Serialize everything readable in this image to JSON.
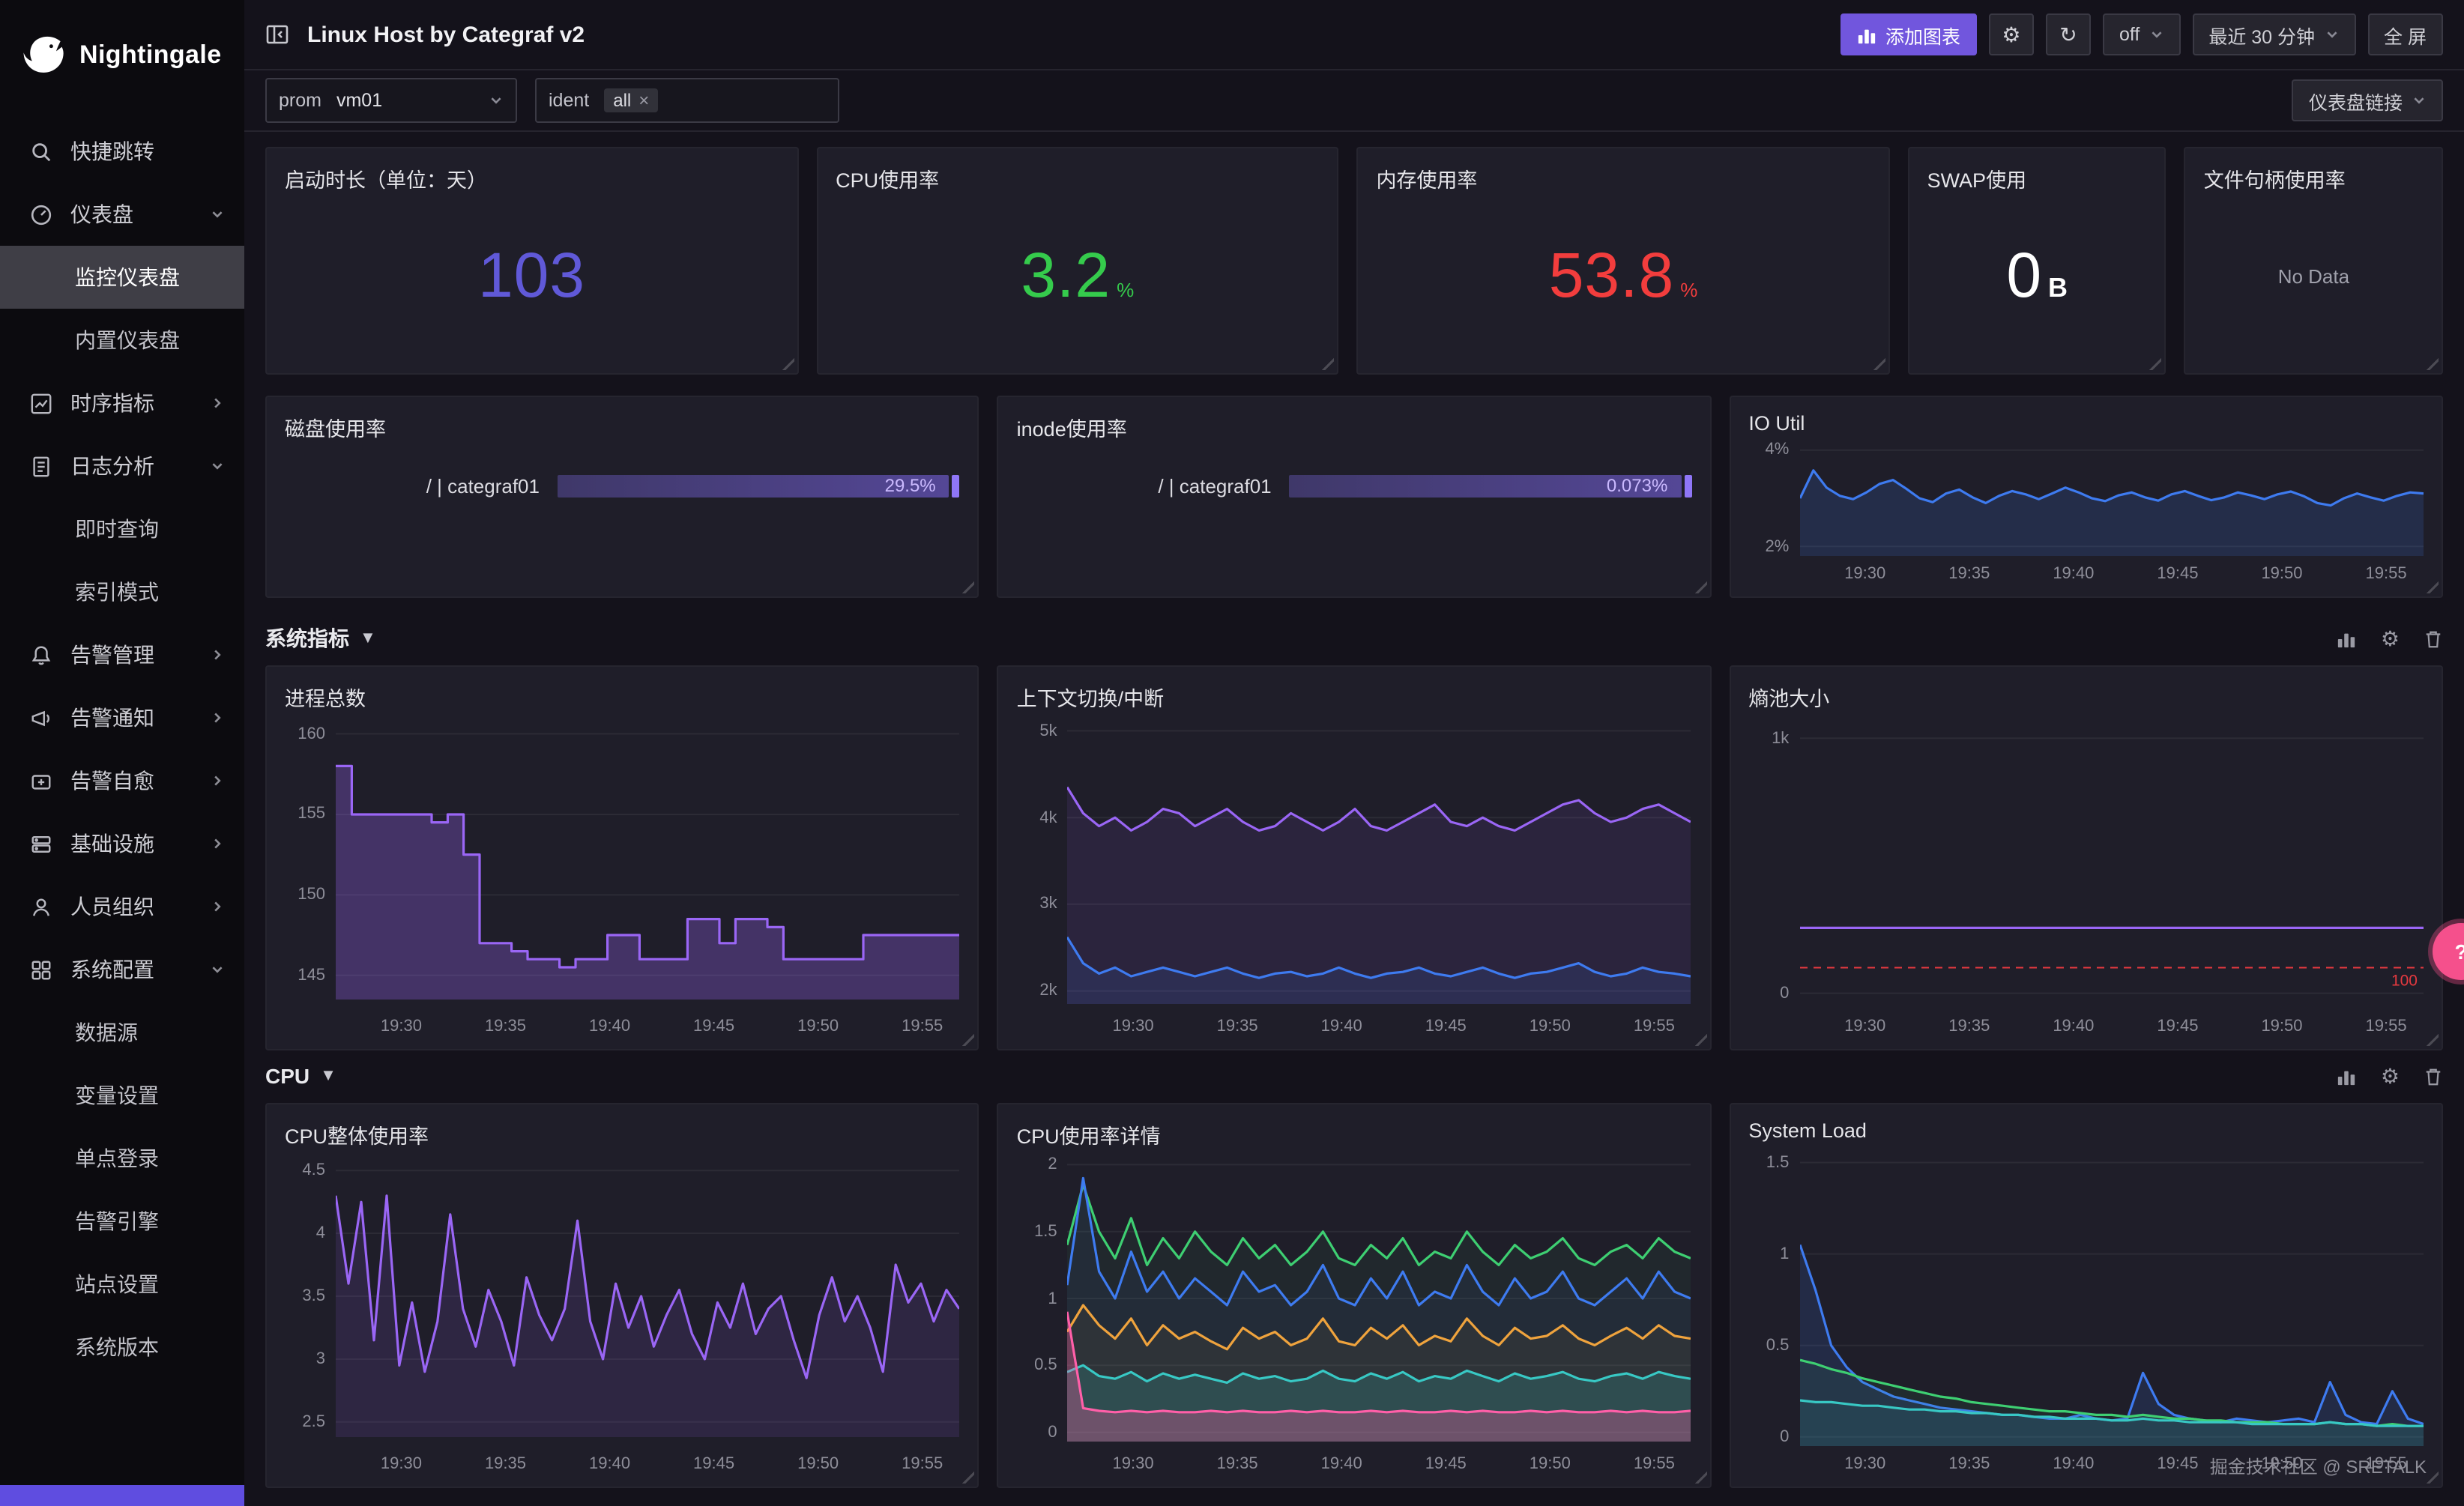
{
  "sidebar": {
    "logo_text": "Nightingale",
    "items": [
      {
        "key": "quick-jump",
        "label": "快捷跳转",
        "icon": "search",
        "type": "top"
      },
      {
        "key": "dashboards",
        "label": "仪表盘",
        "icon": "gauge",
        "chevron": "down",
        "type": "top"
      },
      {
        "key": "monitor-dashboards",
        "label": "监控仪表盘",
        "type": "child",
        "active": true
      },
      {
        "key": "builtin-dashboards",
        "label": "内置仪表盘",
        "type": "child"
      },
      {
        "key": "metrics",
        "label": "时序指标",
        "icon": "chart",
        "chevron": "right",
        "type": "top"
      },
      {
        "key": "log-analysis",
        "label": "日志分析",
        "icon": "log",
        "chevron": "down",
        "type": "top"
      },
      {
        "key": "instant-query",
        "label": "即时查询",
        "type": "child"
      },
      {
        "key": "index-pattern",
        "label": "索引模式",
        "type": "child"
      },
      {
        "key": "alert-manage",
        "label": "告警管理",
        "icon": "bell",
        "chevron": "right",
        "type": "top"
      },
      {
        "key": "alert-notify",
        "label": "告警通知",
        "icon": "speaker",
        "chevron": "right",
        "type": "top"
      },
      {
        "key": "alert-selfheal",
        "label": "告警自愈",
        "icon": "heal",
        "chevron": "right",
        "type": "top"
      },
      {
        "key": "infrastructure",
        "label": "基础设施",
        "icon": "server",
        "chevron": "right",
        "type": "top"
      },
      {
        "key": "org",
        "label": "人员组织",
        "icon": "user",
        "chevron": "right",
        "type": "top"
      },
      {
        "key": "system-config",
        "label": "系统配置",
        "icon": "grid",
        "chevron": "down",
        "type": "top"
      },
      {
        "key": "datasource",
        "label": "数据源",
        "type": "child"
      },
      {
        "key": "variables",
        "label": "变量设置",
        "type": "child"
      },
      {
        "key": "sso",
        "label": "单点登录",
        "type": "child"
      },
      {
        "key": "alert-engine",
        "label": "告警引擎",
        "type": "child"
      },
      {
        "key": "site-settings",
        "label": "站点设置",
        "type": "child"
      },
      {
        "key": "system-version",
        "label": "系统版本",
        "type": "child"
      }
    ]
  },
  "header": {
    "title": "Linux Host by Categraf v2",
    "add_chart": "添加图表",
    "refresh_interval": "off",
    "time_range": "最近 30 分钟",
    "fullscreen": "全 屏"
  },
  "filters": {
    "prom_label": "prom",
    "prom_value": "vm01",
    "ident_label": "ident",
    "ident_value": "all",
    "links": "仪表盘链接"
  },
  "sections": [
    {
      "label": "系统指标"
    },
    {
      "label": "CPU"
    }
  ],
  "watermark": "掘金技术社区 @ SRETALK",
  "stat_cards": [
    {
      "key": "uptime",
      "title": "启动时长（单位：天）",
      "value": "103",
      "unit": "",
      "color": "#6059d8"
    },
    {
      "key": "cpu-usage",
      "title": "CPU使用率",
      "value": "3.2",
      "unit": "%",
      "color": "#35cb4c"
    },
    {
      "key": "mem-usage",
      "title": "内存使用率",
      "value": "53.8",
      "unit": "%",
      "color": "#f23d3d"
    },
    {
      "key": "swap-usage",
      "title": "SWAP使用",
      "value": "0",
      "unit": "B",
      "color": "#ffffff"
    },
    {
      "key": "filefd-usage",
      "title": "文件句柄使用率",
      "value": "No Data",
      "unit": "",
      "color": "#9fa0ab",
      "nodata": true
    }
  ],
  "gauge_panels": [
    {
      "key": "disk-usage",
      "title": "磁盘使用率",
      "row_label": "/ | categraf01",
      "value": "29.5%"
    },
    {
      "key": "inode-usage",
      "title": "inode使用率",
      "row_label": "/ | categraf01",
      "value": "0.073%"
    }
  ],
  "chart_defaults": {
    "x_ticks": [
      "19:30",
      "19:35",
      "19:40",
      "19:45",
      "19:50",
      "19:55"
    ]
  },
  "chart_data": [
    {
      "key": "io-util",
      "row": "row2",
      "title": "IO Util",
      "type": "line",
      "y_min": 1.8,
      "y_max": 4.2,
      "y_ticks": [
        {
          "v": 4,
          "l": "4%"
        },
        {
          "v": 2,
          "l": "2%"
        }
      ],
      "series": [
        {
          "name": "io-util",
          "color": "#3e7bf0",
          "fill": 0.16,
          "values": [
            3.0,
            3.58,
            3.22,
            3.05,
            2.98,
            3.12,
            3.3,
            3.38,
            3.2,
            3.0,
            2.92,
            3.1,
            3.18,
            3.02,
            2.9,
            3.05,
            3.15,
            3.08,
            2.98,
            3.1,
            3.22,
            3.12,
            3.0,
            2.94,
            3.06,
            3.12,
            3.02,
            2.95,
            3.08,
            3.15,
            3.05,
            2.96,
            3.02,
            3.12,
            3.06,
            2.98,
            3.08,
            3.14,
            3.04,
            2.9,
            2.85,
            3.0,
            3.1,
            3.02,
            2.95,
            3.05,
            3.12,
            3.1
          ]
        }
      ]
    },
    {
      "key": "process-total",
      "row": "row3",
      "title": "进程总数",
      "type": "line",
      "step": true,
      "y_min": 143.5,
      "y_max": 161,
      "y_ticks": [
        {
          "v": 160,
          "l": "160"
        },
        {
          "v": 155,
          "l": "155"
        },
        {
          "v": 150,
          "l": "150"
        },
        {
          "v": 145,
          "l": "145"
        }
      ],
      "series": [
        {
          "name": "processes",
          "color": "#9a66f5",
          "fill": 0.3,
          "values": [
            158,
            155,
            155,
            155,
            155,
            155,
            154.5,
            155,
            152.5,
            147,
            147,
            146.5,
            146,
            146,
            145.5,
            146,
            146,
            147.5,
            147.5,
            146,
            146,
            146,
            148.5,
            148.5,
            147,
            148.5,
            148.5,
            148,
            146,
            146,
            146,
            146,
            146,
            147.5,
            147.5,
            147.5,
            147.5,
            147.5,
            147.5,
            147.5
          ]
        }
      ]
    },
    {
      "key": "context-switch",
      "row": "row3",
      "title": "上下文切换/中断",
      "type": "line",
      "y_min": 1850,
      "y_max": 5150,
      "y_ticks": [
        {
          "v": 5000,
          "l": "5k"
        },
        {
          "v": 4000,
          "l": "4k"
        },
        {
          "v": 3000,
          "l": "3k"
        },
        {
          "v": 2000,
          "l": "2k"
        }
      ],
      "series": [
        {
          "name": "context-switch",
          "color": "#9a66f5",
          "fill": 0.1,
          "values": [
            4350,
            4050,
            3900,
            4000,
            3850,
            3950,
            4100,
            4050,
            3900,
            4000,
            4100,
            3950,
            3850,
            3900,
            4050,
            3950,
            3850,
            3950,
            4100,
            3900,
            3850,
            3950,
            4050,
            4150,
            3950,
            3900,
            4000,
            3900,
            3850,
            3950,
            4050,
            4150,
            4200,
            4050,
            3950,
            4000,
            4100,
            4150,
            4050,
            3950
          ]
        },
        {
          "name": "interrupts",
          "color": "#3e7bf0",
          "fill": 0.12,
          "values": [
            2620,
            2320,
            2200,
            2270,
            2170,
            2220,
            2270,
            2220,
            2170,
            2220,
            2270,
            2200,
            2150,
            2200,
            2220,
            2170,
            2200,
            2270,
            2200,
            2150,
            2200,
            2220,
            2270,
            2200,
            2170,
            2220,
            2270,
            2200,
            2150,
            2200,
            2220,
            2270,
            2320,
            2220,
            2170,
            2200,
            2270,
            2220,
            2200,
            2170
          ]
        }
      ]
    },
    {
      "key": "entropy",
      "row": "row3",
      "title": "熵池大小",
      "type": "line",
      "y_min": -60,
      "y_max": 1080,
      "y_ticks": [
        {
          "v": 1000,
          "l": "1k"
        },
        {
          "v": 0,
          "l": "0"
        }
      ],
      "threshold": {
        "v": 100,
        "label": "100",
        "color": "#e5393f"
      },
      "series": [
        {
          "name": "entropy",
          "color": "#9a66f5",
          "fill": 0,
          "values": [
            256,
            256,
            256,
            256,
            256,
            256,
            256,
            256,
            256,
            256
          ]
        }
      ]
    },
    {
      "key": "cpu-overall",
      "row": "row4",
      "title": "CPU整体使用率",
      "type": "line",
      "y_min": 2.38,
      "y_max": 4.62,
      "y_ticks": [
        {
          "v": 4.5,
          "l": "4.5"
        },
        {
          "v": 4,
          "l": "4"
        },
        {
          "v": 3.5,
          "l": "3.5"
        },
        {
          "v": 3,
          "l": "3"
        },
        {
          "v": 2.5,
          "l": "2.5"
        }
      ],
      "series": [
        {
          "name": "cpu-usage",
          "color": "#9a66f5",
          "fill": 0.12,
          "values": [
            4.3,
            3.6,
            4.25,
            3.15,
            4.3,
            2.95,
            3.45,
            2.9,
            3.3,
            4.15,
            3.4,
            3.1,
            3.55,
            3.3,
            2.95,
            3.65,
            3.35,
            3.15,
            3.4,
            4.1,
            3.3,
            3.0,
            3.6,
            3.25,
            3.5,
            3.1,
            3.35,
            3.55,
            3.2,
            3.0,
            3.45,
            3.25,
            3.6,
            3.2,
            3.4,
            3.5,
            3.15,
            2.85,
            3.35,
            3.65,
            3.3,
            3.5,
            3.25,
            2.9,
            3.75,
            3.45,
            3.6,
            3.3,
            3.55,
            3.4
          ]
        }
      ]
    },
    {
      "key": "cpu-detail",
      "row": "row4",
      "title": "CPU使用率详情",
      "type": "line",
      "y_min": -0.07,
      "y_max": 2.07,
      "y_ticks": [
        {
          "v": 2,
          "l": "2"
        },
        {
          "v": 1.5,
          "l": "1.5"
        },
        {
          "v": 1,
          "l": "1"
        },
        {
          "v": 0.5,
          "l": "0.5"
        },
        {
          "v": 0,
          "l": "0"
        }
      ],
      "series": [
        {
          "name": "series-green",
          "color": "#3ecf72",
          "fill": 0.06,
          "values": [
            1.4,
            1.85,
            1.5,
            1.3,
            1.6,
            1.25,
            1.45,
            1.3,
            1.5,
            1.35,
            1.25,
            1.45,
            1.3,
            1.4,
            1.25,
            1.35,
            1.5,
            1.3,
            1.25,
            1.4,
            1.3,
            1.45,
            1.25,
            1.35,
            1.3,
            1.5,
            1.35,
            1.25,
            1.4,
            1.3,
            1.35,
            1.45,
            1.3,
            1.25,
            1.35,
            1.4,
            1.3,
            1.45,
            1.35,
            1.3
          ]
        },
        {
          "name": "series-blue",
          "color": "#3e7bf0",
          "fill": 0.06,
          "values": [
            1.1,
            1.9,
            1.2,
            1.0,
            1.35,
            1.05,
            1.2,
            1.0,
            1.15,
            1.05,
            0.95,
            1.2,
            1.05,
            1.1,
            0.95,
            1.05,
            1.25,
            1.0,
            0.95,
            1.15,
            1.0,
            1.2,
            0.95,
            1.05,
            1.0,
            1.25,
            1.05,
            0.95,
            1.15,
            1.0,
            1.05,
            1.2,
            1.0,
            0.95,
            1.05,
            1.15,
            1.0,
            1.2,
            1.05,
            1.0
          ]
        },
        {
          "name": "series-orange",
          "color": "#efa33d",
          "fill": 0.06,
          "values": [
            0.75,
            0.95,
            0.8,
            0.7,
            0.85,
            0.65,
            0.8,
            0.7,
            0.75,
            0.68,
            0.62,
            0.78,
            0.7,
            0.75,
            0.65,
            0.7,
            0.85,
            0.68,
            0.65,
            0.78,
            0.7,
            0.8,
            0.65,
            0.72,
            0.68,
            0.85,
            0.72,
            0.65,
            0.78,
            0.7,
            0.72,
            0.8,
            0.7,
            0.65,
            0.72,
            0.78,
            0.7,
            0.8,
            0.72,
            0.7
          ]
        },
        {
          "name": "series-cyan",
          "color": "#38c8c4",
          "fill": 0.18,
          "values": [
            0.45,
            0.5,
            0.42,
            0.4,
            0.45,
            0.38,
            0.44,
            0.4,
            0.43,
            0.4,
            0.37,
            0.44,
            0.4,
            0.42,
            0.38,
            0.4,
            0.46,
            0.4,
            0.38,
            0.44,
            0.4,
            0.45,
            0.38,
            0.42,
            0.4,
            0.46,
            0.42,
            0.38,
            0.44,
            0.4,
            0.42,
            0.45,
            0.4,
            0.38,
            0.42,
            0.44,
            0.4,
            0.45,
            0.42,
            0.4
          ]
        },
        {
          "name": "series-pink",
          "color": "#ff5fa8",
          "fill": 0.3,
          "values": [
            0.9,
            0.18,
            0.16,
            0.15,
            0.16,
            0.15,
            0.16,
            0.15,
            0.15,
            0.16,
            0.15,
            0.16,
            0.15,
            0.15,
            0.16,
            0.15,
            0.16,
            0.15,
            0.15,
            0.16,
            0.15,
            0.16,
            0.15,
            0.15,
            0.16,
            0.15,
            0.16,
            0.15,
            0.15,
            0.16,
            0.15,
            0.16,
            0.15,
            0.15,
            0.16,
            0.15,
            0.16,
            0.15,
            0.15,
            0.16
          ]
        }
      ]
    },
    {
      "key": "system-load",
      "row": "row4",
      "title": "System Load",
      "type": "line",
      "watermark": true,
      "y_min": -0.05,
      "y_max": 1.58,
      "y_ticks": [
        {
          "v": 1.5,
          "l": "1.5"
        },
        {
          "v": 1,
          "l": "1"
        },
        {
          "v": 0.5,
          "l": "0.5"
        },
        {
          "v": 0,
          "l": "0"
        }
      ],
      "series": [
        {
          "name": "load-blue",
          "color": "#3e7bf0",
          "fill": 0.15,
          "values": [
            1.05,
            0.8,
            0.5,
            0.38,
            0.3,
            0.26,
            0.22,
            0.2,
            0.18,
            0.16,
            0.15,
            0.14,
            0.13,
            0.12,
            0.12,
            0.11,
            0.1,
            0.1,
            0.12,
            0.1,
            0.09,
            0.1,
            0.35,
            0.18,
            0.12,
            0.1,
            0.09,
            0.08,
            0.1,
            0.09,
            0.08,
            0.09,
            0.1,
            0.08,
            0.3,
            0.12,
            0.08,
            0.07,
            0.25,
            0.1,
            0.07
          ]
        },
        {
          "name": "load-green",
          "color": "#3ecf72",
          "fill": 0.08,
          "values": [
            0.42,
            0.4,
            0.37,
            0.35,
            0.32,
            0.3,
            0.28,
            0.26,
            0.24,
            0.22,
            0.21,
            0.19,
            0.18,
            0.17,
            0.16,
            0.15,
            0.14,
            0.14,
            0.13,
            0.12,
            0.12,
            0.11,
            0.12,
            0.11,
            0.1,
            0.1,
            0.09,
            0.09,
            0.08,
            0.08,
            0.08,
            0.07,
            0.07,
            0.07,
            0.08,
            0.07,
            0.07,
            0.06,
            0.07,
            0.06,
            0.06
          ]
        },
        {
          "name": "load-cyan",
          "color": "#38c8c4",
          "fill": 0.08,
          "values": [
            0.2,
            0.19,
            0.19,
            0.18,
            0.17,
            0.17,
            0.16,
            0.15,
            0.15,
            0.14,
            0.14,
            0.13,
            0.13,
            0.12,
            0.12,
            0.11,
            0.11,
            0.1,
            0.1,
            0.1,
            0.09,
            0.09,
            0.1,
            0.09,
            0.09,
            0.08,
            0.08,
            0.08,
            0.08,
            0.07,
            0.07,
            0.07,
            0.07,
            0.07,
            0.08,
            0.07,
            0.07,
            0.06,
            0.06,
            0.06,
            0.06
          ]
        }
      ]
    }
  ]
}
